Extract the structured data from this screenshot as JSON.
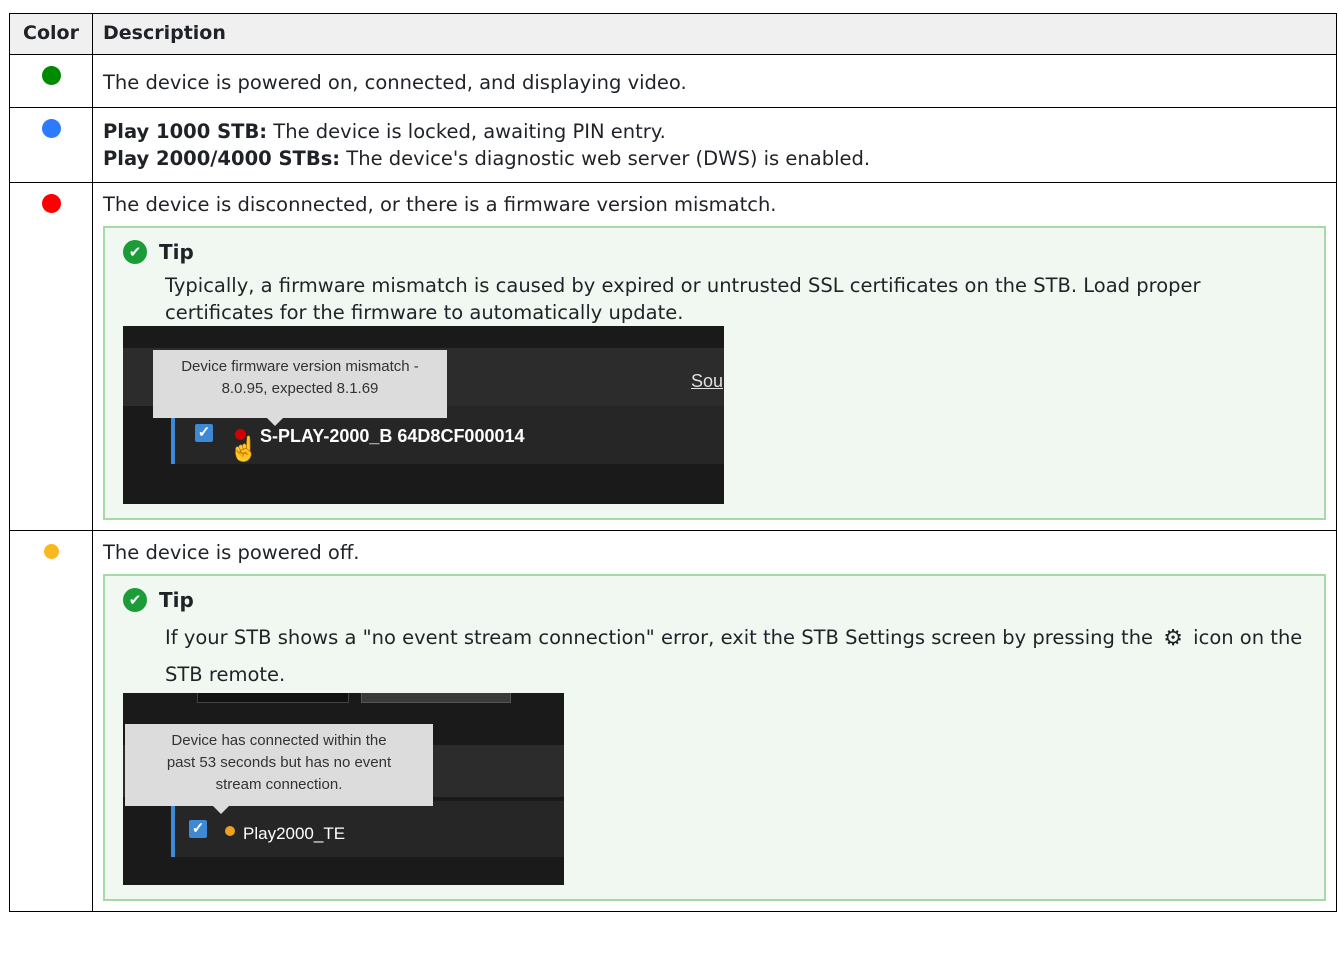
{
  "table": {
    "headers": {
      "color": "Color",
      "description": "Description"
    },
    "colors": {
      "green": "#008a00",
      "blue": "#2c7bff",
      "red": "#ff0000",
      "yellow": "#f8b820"
    },
    "rows": [
      {
        "color_name": "green",
        "text": "The device is powered on, connected, and displaying video."
      },
      {
        "color_name": "blue",
        "line1_label": "Play 1000 STB:",
        "line1_text": " The device is locked, awaiting PIN entry.",
        "line2_label": "Play 2000/4000 STBs:",
        "line2_text": " The device's diagnostic web server (DWS) is enabled."
      },
      {
        "color_name": "red",
        "text": "The device is disconnected, or there is a firmware version mismatch.",
        "tip": {
          "title": "Tip",
          "body": "Typically, a firmware mismatch is caused by expired or untrusted SSL certificates on the STB. Load proper certificates for the firmware to automatically update.",
          "screenshot": {
            "tooltip_line1": "Device firmware version mismatch -",
            "tooltip_line2": "8.0.95, expected 8.1.69",
            "link_text": "Sou",
            "device_name": "S-PLAY-2000_B 64D8CF000014"
          }
        }
      },
      {
        "color_name": "yellow",
        "text": "The device is powered off.",
        "tip": {
          "title": "Tip",
          "body_before_icon": "If your STB shows a \"no event stream connection\" error, exit the STB Settings screen by pressing the ",
          "icon": "gear-icon",
          "body_after_icon": " icon on the STB remote.",
          "screenshot": {
            "tooltip_line1": "Device has connected within the",
            "tooltip_line2": "past 53 seconds but has no event",
            "tooltip_line3": "stream connection.",
            "device_name": "Play2000_TE"
          }
        }
      }
    ]
  }
}
